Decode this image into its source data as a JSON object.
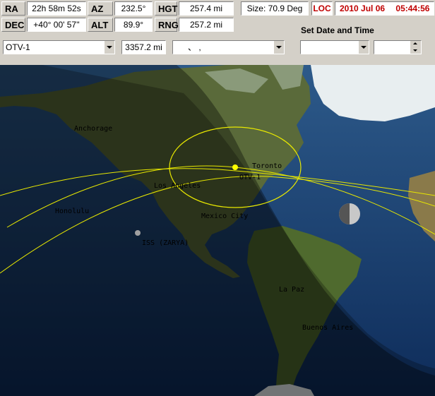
{
  "readouts": {
    "ra_label": "RA",
    "ra_value": "22h 58m 52s",
    "az_label": "AZ",
    "az_value": "232.5°",
    "hgt_label": "HGT",
    "hgt_value": "257.4 mi",
    "dec_label": "DEC",
    "dec_value": "+40° 00' 57''",
    "alt_label": "ALT",
    "alt_value": "89.9°",
    "rng_label": "RNG",
    "rng_value": "257.2 mi"
  },
  "size_label": "Size: 70.9 Deg",
  "loc_label": "LOC",
  "date": "2010 Jul 06",
  "time": "05:44:56",
  "satellite_select": "OTV-1",
  "distance": "3357.2 mi",
  "secondary_select": "、  ,",
  "set_datetime_label": "Set  Date and Time",
  "map": {
    "cities": [
      "Anchorage",
      "Toronto",
      "Los Angeles",
      "Honolulu",
      "Mexico City",
      "La Paz",
      "Buenos Aires"
    ],
    "satellites": [
      "OTV-1",
      "ISS (ZARYA)"
    ]
  },
  "colors": {
    "track": "#e8e800",
    "sat": "#ffff00",
    "alert": "#c00000"
  }
}
